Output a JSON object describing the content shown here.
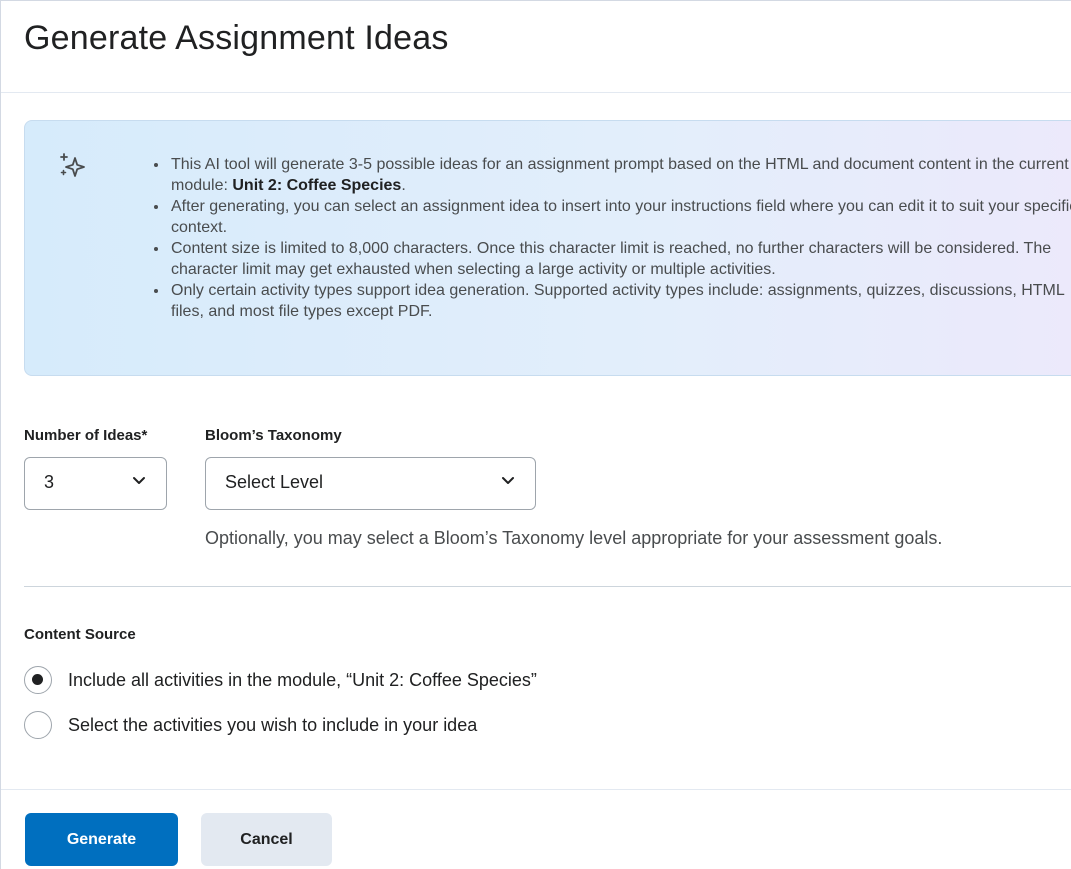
{
  "dialog": {
    "title": "Generate Assignment Ideas"
  },
  "info": {
    "icon": "sparkle-icon",
    "bullets": [
      {
        "text": "This AI tool will generate 3-5 possible ideas for an assignment prompt based on the HTML and document content in the current module: ",
        "bold": "Unit 2: Coffee Species",
        "suffix": "."
      },
      {
        "text": "After generating, you can select an assignment idea to insert into your instructions field where you can edit it to suit your specific context."
      },
      {
        "text": "Content size is limited to 8,000 characters. Once this character limit is reached, no further characters will be considered. The character limit may get exhausted when selecting a large activity or multiple activities."
      },
      {
        "text": "Only certain activity types support idea generation. Supported activity types include: assignments, quizzes, discussions, HTML files, and most file types except PDF."
      }
    ]
  },
  "form": {
    "num_ideas": {
      "label": "Number of Ideas*",
      "value": "3"
    },
    "blooms": {
      "label": "Bloom’s Taxonomy",
      "value": "Select Level",
      "help": "Optionally, you may select a Bloom’s Taxonomy level appropriate for your assessment goals."
    }
  },
  "content_source": {
    "label": "Content Source",
    "options": [
      {
        "label": "Include all activities in the module, “Unit 2: Coffee Species”",
        "checked": true
      },
      {
        "label": "Select the activities you wish to include in your idea",
        "checked": false
      }
    ]
  },
  "buttons": {
    "generate": "Generate",
    "cancel": "Cancel"
  },
  "colors": {
    "primary": "#006fbf",
    "secondary": "#e3e9f1",
    "info_bg_start": "#d6ebfb",
    "info_bg_end": "#ece9fb"
  }
}
